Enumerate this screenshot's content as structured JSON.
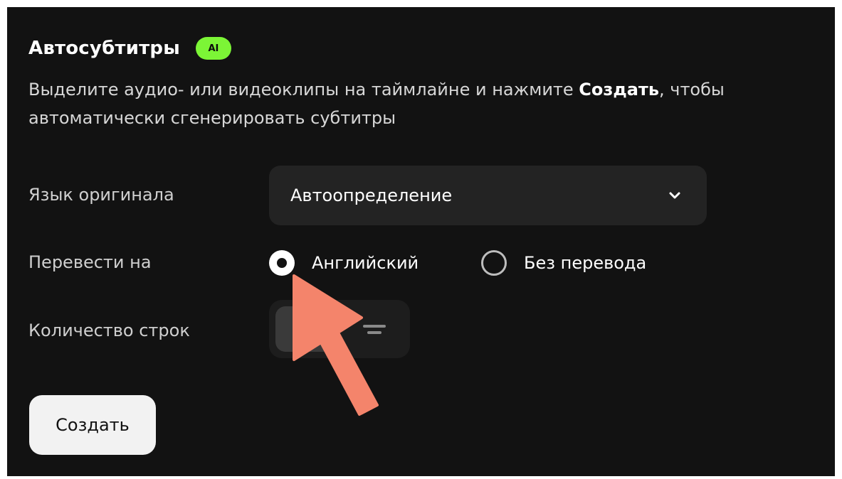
{
  "panel": {
    "title": "Автосубтитры",
    "ai_badge": "AI",
    "description_before": "Выделите аудио- или видеоклипы на таймлайне и нажмите ",
    "description_bold": "Создать",
    "description_after": ", чтобы автоматически сгенерировать субтитры"
  },
  "source_language": {
    "label": "Язык оригинала",
    "selected": "Автоопределение",
    "icon": "chevron-down-icon"
  },
  "translate_to": {
    "label": "Перевести на",
    "options": [
      {
        "label": "Английский",
        "selected": true
      },
      {
        "label": "Без перевода",
        "selected": false
      }
    ]
  },
  "line_count": {
    "label": "Количество строк",
    "options": [
      {
        "icon": "single-line-icon",
        "selected": true
      },
      {
        "icon": "two-lines-icon",
        "selected": false
      }
    ]
  },
  "create_button": "Создать",
  "colors": {
    "background": "#121212",
    "badge": "#7cf536",
    "annotation_arrow": "#f4846b"
  },
  "annotation": {
    "icon": "pointer-arrow-icon"
  }
}
